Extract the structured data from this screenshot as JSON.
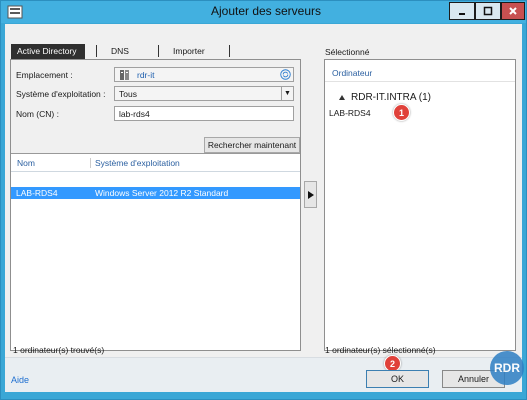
{
  "window": {
    "title": "Ajouter des serveurs"
  },
  "tabs": [
    {
      "label": "Active Directory"
    },
    {
      "label": "DNS"
    },
    {
      "label": "Importer"
    }
  ],
  "filters": {
    "location_label": "Emplacement :",
    "location_value": "rdr-it",
    "os_label": "Système d'exploitation :",
    "os_value": "Tous",
    "name_label": "Nom (CN) :",
    "name_value": "lab-rds4",
    "search_button": "Rechercher maintenant"
  },
  "results": {
    "columns": [
      "Nom",
      "Système d'exploitation"
    ],
    "rows": [
      {
        "name": "LAB-RDS4",
        "os": "Windows Server 2012 R2 Standard"
      }
    ],
    "status": "1 ordinateur(s) trouvé(s)"
  },
  "selected": {
    "title": "Sélectionné",
    "column": "Ordinateur",
    "group": "RDR-IT.INTRA (1)",
    "items": [
      "LAB-RDS4"
    ],
    "status": "1 ordinateur(s) sélectionné(s)"
  },
  "annotations": [
    "1",
    "2"
  ],
  "footer": {
    "help": "Aide",
    "ok": "OK",
    "cancel": "Annuler"
  },
  "logo_text": "RDR",
  "colors": {
    "titlebar": "#42b0e0",
    "selection": "#3399ff",
    "badge": "#e0413a",
    "link": "#1e6fd0"
  }
}
